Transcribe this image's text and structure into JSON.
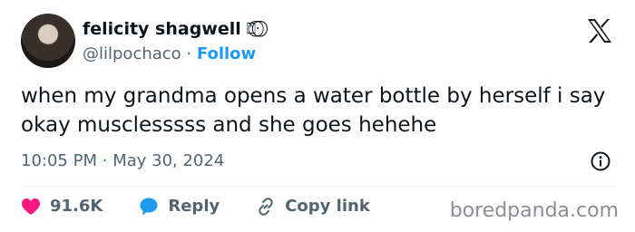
{
  "author": {
    "display_name": "felicity shagwell",
    "name_glyphs": "⍞·⃝ ⃝⃝",
    "handle": "@lilpochaco",
    "separator": "·",
    "follow_label": "Follow"
  },
  "tweet": {
    "text": "when my grandma opens a water bottle by herself i say okay musclesssss and she goes hehehe",
    "time": "10:05 PM",
    "dot": "·",
    "date": "May 30, 2024"
  },
  "actions": {
    "likes_count": "91.6K",
    "reply_label": "Reply",
    "copy_link_label": "Copy link"
  },
  "watermark": "boredpanda.com",
  "icons": {
    "logo": "x-logo-icon",
    "info": "info-icon",
    "like": "heart-icon",
    "reply": "speech-bubble-icon",
    "link": "link-icon"
  },
  "colors": {
    "like": "#f91880",
    "reply": "#1d9bf0",
    "follow": "#1d9bf0",
    "secondary_text": "#536471"
  }
}
